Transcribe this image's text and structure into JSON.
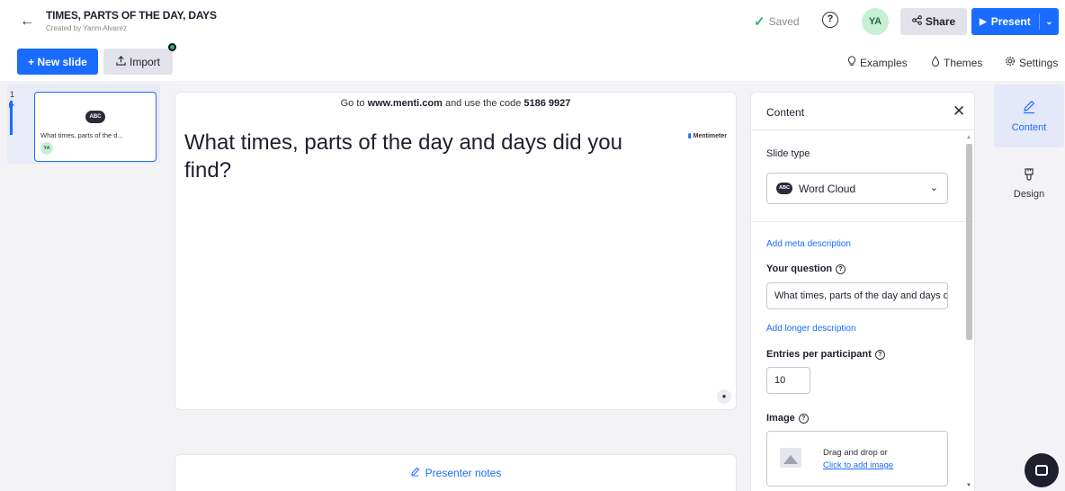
{
  "header": {
    "title": "TIMES, PARTS OF THE DAY, DAYS",
    "subtitle": "Created by Yarim Alvarez",
    "saved_label": "Saved",
    "help_glyph": "?",
    "avatar_initials": "YA",
    "share_label": "Share",
    "present_label": "Present"
  },
  "toolbar": {
    "new_slide_label": "+ New slide",
    "import_label": "Import",
    "examples_label": "Examples",
    "themes_label": "Themes",
    "settings_label": "Settings"
  },
  "slide_list": {
    "slide_number": "1",
    "thumb_icon_text": "ABC",
    "thumb_title": "What times, parts of the d...",
    "thumb_avatar": "YA"
  },
  "slide": {
    "instruction_prefix": "Go to ",
    "instruction_url": "www.menti.com",
    "instruction_middle": " and use the code ",
    "instruction_code": "5186 9927",
    "brand": "Mentimeter",
    "question": "What times, parts of the day and days did you find?"
  },
  "presenter_notes_label": "Presenter notes",
  "content_panel": {
    "title": "Content",
    "close_glyph": "✕",
    "slide_type_label": "Slide type",
    "slide_type_icon_text": "ABC",
    "slide_type_value": "Word Cloud",
    "add_meta_link": "Add meta description",
    "question_label": "Your question",
    "question_value": "What times, parts of the day and days did you find?",
    "add_longer_link": "Add longer description",
    "entries_label": "Entries per participant",
    "entries_value": "10",
    "image_label": "Image",
    "drop_text": "Drag and drop or",
    "drop_link": "Click to add image"
  },
  "right_rail": {
    "content_label": "Content",
    "design_label": "Design"
  },
  "icons": {
    "back": "arrow-left-icon",
    "saved": "checkmark-icon",
    "share": "share-icon",
    "present": "play-icon",
    "import": "upload-icon",
    "examples": "lightbulb-icon",
    "themes": "drop-icon",
    "settings": "gear-icon",
    "notes": "pencil-icon",
    "chat": "chat-icon"
  },
  "colors": {
    "accent": "#196cff",
    "saved_green": "#2fb36f",
    "avatar_bg": "#c7f0d6"
  }
}
